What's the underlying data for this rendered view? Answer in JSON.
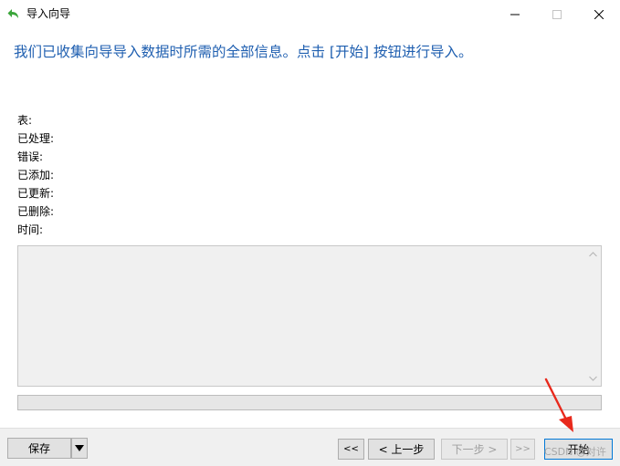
{
  "window": {
    "title": "导入向导",
    "icon": "back-arrow-icon",
    "controls": [
      "minimize-icon",
      "maximize-icon",
      "close-icon"
    ]
  },
  "headline": "我们已收集向导导入数据时所需的全部信息。点击 [开始] 按钮进行导入。",
  "stats": {
    "table_label": "表:",
    "processed_label": "已处理:",
    "errors_label": "错误:",
    "added_label": "已添加:",
    "updated_label": "已更新:",
    "deleted_label": "已删除:",
    "time_label": "时间:"
  },
  "log": {
    "content": ""
  },
  "progress": {
    "value": 0
  },
  "buttons": {
    "save": "保存",
    "first": "<<",
    "prev": "< 上一步",
    "next": "下一步 >",
    "last": ">>",
    "start": "开始"
  },
  "watermark": "CSDN @对许",
  "colors": {
    "headline": "#1f5fb0",
    "annotation_arrow": "#e8291c"
  }
}
